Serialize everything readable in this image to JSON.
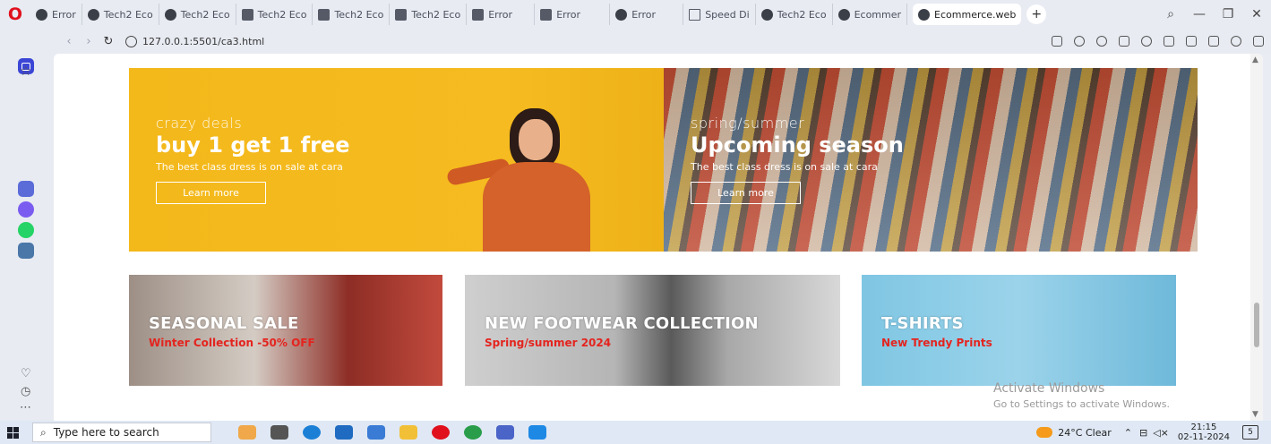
{
  "browser": {
    "tabs": [
      {
        "label": "Error",
        "icon": "globe-icon"
      },
      {
        "label": "Tech2 Eco",
        "icon": "globe-icon"
      },
      {
        "label": "Tech2 Eco",
        "icon": "globe-icon"
      },
      {
        "label": "Tech2 Eco",
        "icon": "document-icon"
      },
      {
        "label": "Tech2 Eco",
        "icon": "document-icon"
      },
      {
        "label": "Tech2 Eco",
        "icon": "document-icon"
      },
      {
        "label": "Error",
        "icon": "document-icon"
      },
      {
        "label": "Error",
        "icon": "document-icon"
      },
      {
        "label": "Error",
        "icon": "globe-icon"
      },
      {
        "label": "Speed Di",
        "icon": "grid-icon"
      },
      {
        "label": "Tech2 Eco",
        "icon": "globe-icon"
      },
      {
        "label": "Ecommer",
        "icon": "globe-icon"
      }
    ],
    "active_tab": "Ecommerce.web",
    "url": "127.0.0.1:5501/ca3.html"
  },
  "banners": [
    {
      "small": "crazy deals",
      "big": "buy 1 get 1 free",
      "desc": "The best class dress is on sale at cara",
      "button": "Learn more"
    },
    {
      "small": "spring/summer",
      "big": "Upcoming season",
      "desc": "The best class dress is on sale at cara",
      "button": "Learn more"
    }
  ],
  "categories": [
    {
      "title": "SEASONAL SALE",
      "subtitle": "Winter Collection -50% OFF"
    },
    {
      "title": "NEW FOOTWEAR COLLECTION",
      "subtitle": "Spring/summer 2024"
    },
    {
      "title": "T-SHIRTS",
      "subtitle": "New Trendy Prints"
    }
  ],
  "watermark": {
    "line1": "Activate Windows",
    "line2": "Go to Settings to activate Windows."
  },
  "taskbar": {
    "search_placeholder": "Type here to search",
    "weather": "24°C  Clear",
    "time": "21:15",
    "date": "02-11-2024",
    "notifications": "5"
  },
  "colors": {
    "accent": "#3b46d6",
    "sale_red": "#e4241f",
    "banner_yellow": "#f5bb20"
  }
}
